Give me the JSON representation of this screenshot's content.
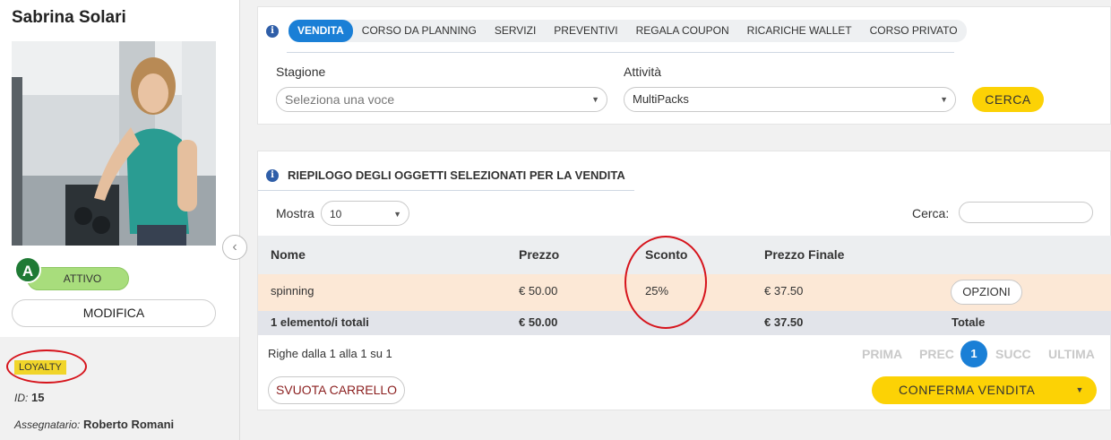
{
  "client": {
    "name": "Sabrina Solari",
    "status_letter": "A",
    "status_label": "ATTIVO",
    "modify_label": "MODIFICA",
    "badge": "LOYALTY",
    "id_label": "ID:",
    "id_value": "15",
    "assignee_label": "Assegnatario:",
    "assignee_value": "Roberto Romani"
  },
  "tabs": [
    "VENDITA",
    "CORSO DA PLANNING",
    "SERVIZI",
    "PREVENTIVI",
    "REGALA COUPON",
    "RICARICHE WALLET",
    "CORSO PRIVATO"
  ],
  "filters": {
    "season_label": "Stagione",
    "season_placeholder": "Seleziona una voce",
    "activity_label": "Attività",
    "activity_value": "MultiPacks",
    "search_button": "CERCA"
  },
  "summary": {
    "title": "RIEPILOGO DEGLI OGGETTI SELEZIONATI PER LA VENDITA",
    "show_label": "Mostra",
    "show_value": "10",
    "filter_label": "Cerca:",
    "columns": [
      "Nome",
      "Prezzo",
      "Sconto",
      "Prezzo Finale"
    ],
    "row": {
      "name": "spinning",
      "price": "€ 50.00",
      "discount": "25%",
      "final_price": "€ 37.50",
      "options": "OPZIONI"
    },
    "footer": {
      "count": "1 elemento/i totali",
      "price": "€ 50.00",
      "final_price": "€ 37.50",
      "total": "Totale"
    },
    "rows_info": "Righe dalla 1 alla 1 su 1",
    "pager": {
      "first": "PRIMA",
      "prev": "PREC",
      "current": "1",
      "next": "SUCC",
      "last": "ULTIMA"
    },
    "empty_cart": "SVUOTA CARRELLO",
    "confirm": "CONFERMA VENDITA"
  },
  "colors": {
    "accent_blue": "#1a7fd6",
    "accent_yellow": "#fcd205",
    "status_green": "#a8dd7c",
    "highlight_red": "#d6141c",
    "row_highlight": "#fce8d6"
  },
  "icons": [
    "info-icon",
    "chevron-left-icon",
    "caret-down-icon"
  ]
}
